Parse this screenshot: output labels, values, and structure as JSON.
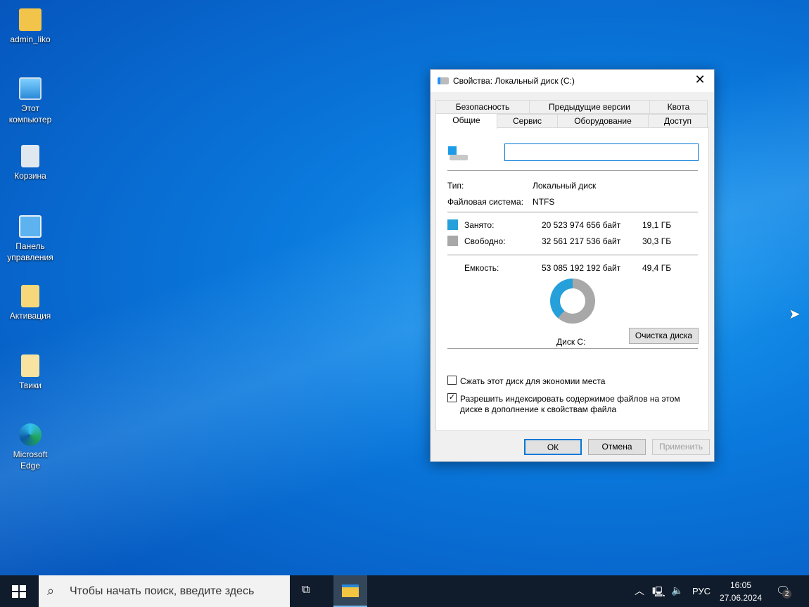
{
  "desktop": {
    "icons": [
      {
        "label": "admin_liko",
        "icon": "user-folder-icon"
      },
      {
        "label": "Этот компьютер",
        "icon": "computer-icon"
      },
      {
        "label": "Корзина",
        "icon": "recycle-bin-icon"
      },
      {
        "label": "Панель управления",
        "icon": "control-panel-icon"
      },
      {
        "label": "Активация",
        "icon": "folder-icon"
      },
      {
        "label": "Твики",
        "icon": "folder-icon"
      },
      {
        "label": "Microsoft Edge",
        "icon": "edge-icon"
      }
    ]
  },
  "dialog": {
    "title": "Свойства: Локальный диск (C:)",
    "tabs_row1": [
      "Безопасность",
      "Предыдущие версии",
      "Квота"
    ],
    "tabs_row2": [
      "Общие",
      "Сервис",
      "Оборудование",
      "Доступ"
    ],
    "active_tab": "Общие",
    "name_value": "",
    "type_label": "Тип:",
    "type_value": "Локальный диск",
    "fs_label": "Файловая система:",
    "fs_value": "NTFS",
    "used_label": "Занято:",
    "used_bytes": "20 523 974 656 байт",
    "used_gb": "19,1 ГБ",
    "free_label": "Свободно:",
    "free_bytes": "32 561 217 536 байт",
    "free_gb": "30,3 ГБ",
    "cap_label": "Емкость:",
    "cap_bytes": "53 085 192 192 байт",
    "cap_gb": "49,4 ГБ",
    "used_fraction": 0.387,
    "used_color": "#26a0da",
    "free_color": "#a8a8a8",
    "disk_label": "Диск C:",
    "cleanup_button": "Очистка диска",
    "compress_label": "Сжать этот диск для экономии места",
    "compress_checked": false,
    "index_label_1": "Разрешить индексировать содержимое файлов на этом",
    "index_label_2": "диске в дополнение к свойствам файла",
    "index_checked": true,
    "ok": "ОК",
    "cancel": "Отмена",
    "apply": "Применить"
  },
  "taskbar": {
    "search_placeholder": "Чтобы начать поиск, введите здесь",
    "lang": "РУС",
    "time": "16:05",
    "date": "27.06.2024",
    "notifications": "2"
  }
}
